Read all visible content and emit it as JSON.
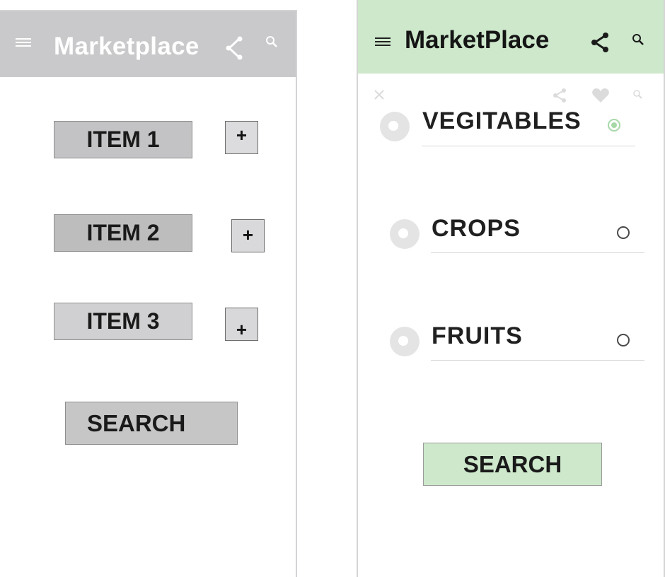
{
  "left": {
    "app_title": "Marketplace",
    "items": [
      {
        "label": "ITEM 1",
        "add_label": "+",
        "color": "#c3c3c5"
      },
      {
        "label": "ITEM 2",
        "add_label": "+",
        "color": "#bdbdbd"
      },
      {
        "label": "ITEM 3",
        "add_label": "+",
        "color": "#d0d0d2"
      }
    ],
    "search_label": "SEARCH",
    "colors": {
      "header": "#c9c9cb",
      "header_text": "#ffffff"
    }
  },
  "right": {
    "app_title": "MarketPlace",
    "categories": [
      {
        "label": "VEGITABLES",
        "selected": true
      },
      {
        "label": "CROPS",
        "selected": false
      },
      {
        "label": "FRUITS",
        "selected": false
      }
    ],
    "search_label": "SEARCH",
    "colors": {
      "header": "#cde8cb",
      "accent": "#a8d8a8"
    }
  },
  "icons": {
    "menu": "menu-icon",
    "share": "share-icon",
    "search": "search-icon",
    "close": "close-icon",
    "favorite": "heart-icon",
    "category": "category-icon"
  }
}
